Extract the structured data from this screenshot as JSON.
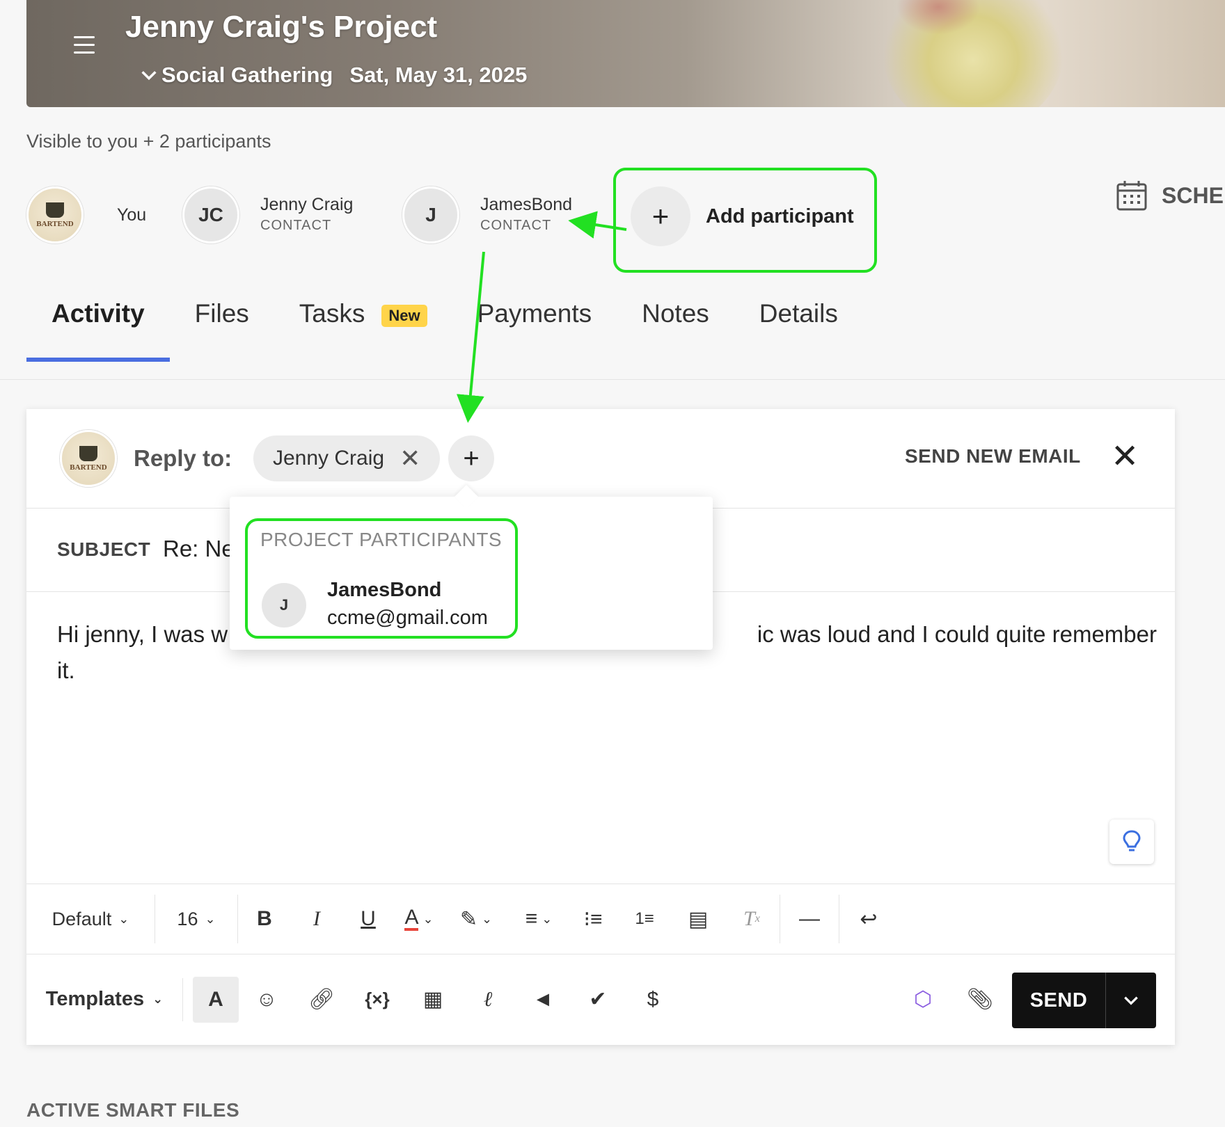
{
  "header": {
    "title": "Jenny Craig's Project",
    "event_type": "Social Gathering",
    "date": "Sat, May 31, 2025"
  },
  "visibility_text": "Visible to you + 2 participants",
  "participants": [
    {
      "name": "You",
      "role": "",
      "initials": "",
      "logo_text": "BARTEND"
    },
    {
      "name": "Jenny Craig",
      "role": "CONTACT",
      "initials": "JC"
    },
    {
      "name": "JamesBond",
      "role": "CONTACT",
      "initials": "J"
    }
  ],
  "add_participant_label": "Add participant",
  "schedule_label": "SCHE",
  "tabs": [
    {
      "label": "Activity",
      "active": true
    },
    {
      "label": "Files"
    },
    {
      "label": "Tasks",
      "badge": "New"
    },
    {
      "label": "Payments"
    },
    {
      "label": "Notes"
    },
    {
      "label": "Details"
    }
  ],
  "composer": {
    "reply_label": "Reply to:",
    "recipient_chip": "Jenny Craig",
    "send_new_email": "SEND NEW EMAIL",
    "subject_label": "SUBJECT",
    "subject_value": "Re: Ne",
    "body_start": "Hi jenny, I was w",
    "body_end": "ic was loud and I could quite remember",
    "body_line2": "it.",
    "font_select": "Default",
    "size_select": "16",
    "templates_label": "Templates",
    "send_label": "SEND"
  },
  "dropdown": {
    "heading": "PROJECT PARTICIPANTS",
    "items": [
      {
        "initials": "J",
        "name": "JamesBond",
        "email": "ccme@gmail.com"
      }
    ]
  },
  "active_smart_files": "ACTIVE SMART FILES",
  "colors": {
    "highlight_green": "#22e022",
    "tab_underline": "#4a6ee0",
    "badge_yellow": "#ffd44a"
  }
}
